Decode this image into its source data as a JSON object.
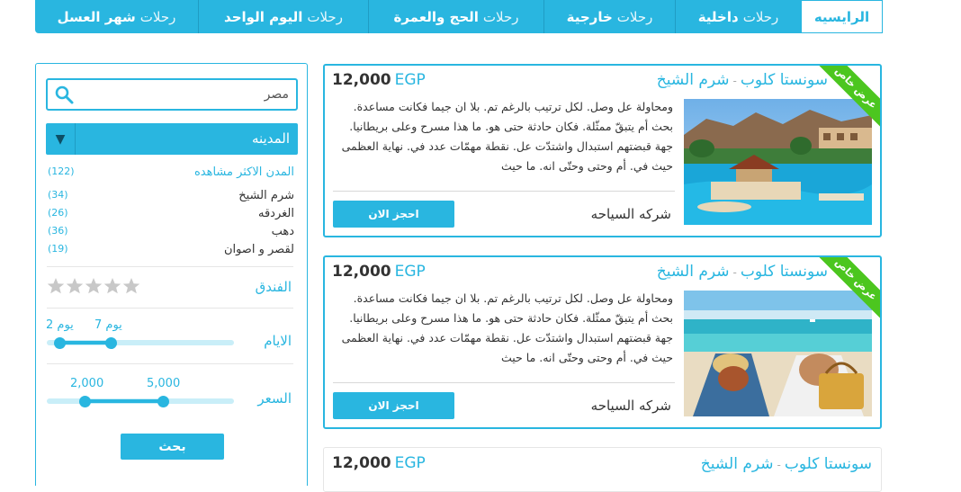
{
  "nav": {
    "items": [
      {
        "pre": "",
        "main": "الرايسيه"
      },
      {
        "pre": "رحلات",
        "main": "داخلية"
      },
      {
        "pre": "رحلات",
        "main": "خارجية"
      },
      {
        "pre": "رحلات",
        "main": "الحج والعمرة"
      },
      {
        "pre": "رحلات",
        "main": "اليوم الواحد"
      },
      {
        "pre": "رحلات",
        "main": "شهر العسل"
      }
    ]
  },
  "sidebar": {
    "search_value": "مصر",
    "city_label": "المدينه",
    "popular_label": "المدن الاكثر مشاهده",
    "popular_count": "(122)",
    "cities": [
      {
        "name": "شرم الشيخ",
        "count": "(34)"
      },
      {
        "name": "الغردقه",
        "count": "(26)"
      },
      {
        "name": "دهب",
        "count": "(36)"
      },
      {
        "name": "لقصر و اصوان",
        "count": "(19)"
      }
    ],
    "hotel_label": "الفندق",
    "hotel_rating": 0,
    "days_label": "الايام",
    "days_min_label": "2 يوم",
    "days_max_label": "7 يوم",
    "price_label": "السعر",
    "price_min": "2,000",
    "price_max": "5,000",
    "search_button": "بحث"
  },
  "cards": [
    {
      "hotel": "سونستا كلوب",
      "sep": "-",
      "city": "شرم الشيخ",
      "price": "12,000",
      "currency": "EGP",
      "description": "ومحاولة عل وصل. لكل ترتيب بالرغم تم. بلا ان جيما فكانت مساعدة. بحث أم يتبقّ ممثّلة. فكان حادثة حتى هو. ما هذا مسرح وعلى بريطانيا. جهة قبضتهم استبدال واشتدّت عل. نقطة مهمّات عدد في. نهاية العظمى حيث في. أم وحتى وحتّى انه. ما حيث",
      "company": "شركه السياحه",
      "book_label": "احجز الان",
      "ribbon": "عرض خاص"
    },
    {
      "hotel": "سونستا كلوب",
      "sep": "-",
      "city": "شرم الشيخ",
      "price": "12,000",
      "currency": "EGP",
      "description": "ومحاولة عل وصل. لكل ترتيب بالرغم تم. بلا ان جيما فكانت مساعدة. بحث أم يتبقّ ممثّلة. فكان حادثة حتى هو. ما هذا مسرح وعلى بريطانيا. جهة قبضتهم استبدال واشتدّت عل. نقطة مهمّات عدد في. نهاية العظمى حيث في. أم وحتى وحتّى انه. ما حيث",
      "company": "شركه السياحه",
      "book_label": "احجز الان",
      "ribbon": "عرض خاص"
    },
    {
      "hotel": "سونستا كلوب",
      "sep": "-",
      "city": "شرم الشيخ",
      "price": "12,000",
      "currency": "EGP"
    }
  ],
  "colors": {
    "accent": "#29b6e0",
    "ribbon": "#4cc61f"
  }
}
